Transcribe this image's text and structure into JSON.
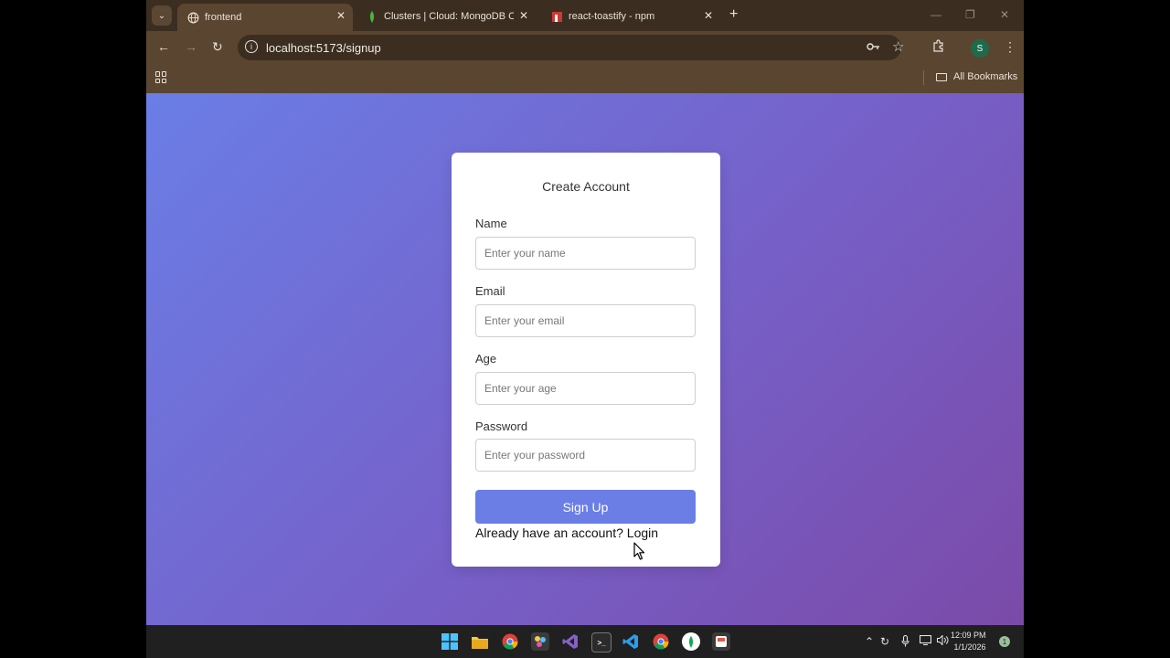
{
  "browser": {
    "tabs": [
      {
        "title": "frontend",
        "active": true,
        "favicon": "globe-icon"
      },
      {
        "title": "Clusters | Cloud: MongoDB Clo",
        "active": false,
        "favicon": "mongodb-leaf-icon"
      },
      {
        "title": "react-toastify - npm",
        "active": false,
        "favicon": "npm-icon"
      }
    ],
    "url": "localhost:5173/signup",
    "bookmarks_label": "All Bookmarks",
    "profile_initial": "S"
  },
  "form": {
    "title": "Create Account",
    "fields": [
      {
        "label": "Name",
        "placeholder": "Enter your name"
      },
      {
        "label": "Email",
        "placeholder": "Enter your email"
      },
      {
        "label": "Age",
        "placeholder": "Enter your age"
      },
      {
        "label": "Password",
        "placeholder": "Enter your password"
      }
    ],
    "submit_label": "Sign Up",
    "login_prompt": "Already have an account?",
    "login_link": "Login"
  },
  "taskbar": {
    "time": "12:09 PM",
    "date": "1/1/2026",
    "notification_count": "1"
  },
  "colors": {
    "primary": "#6a7ee6",
    "gradient_end": "#7b4aa8",
    "chrome": "#5a4530"
  }
}
